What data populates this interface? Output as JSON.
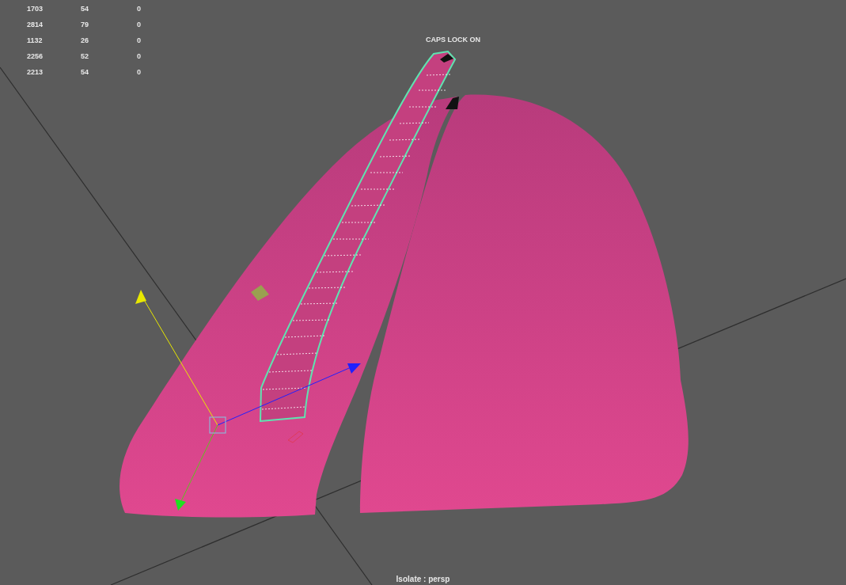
{
  "stats": [
    {
      "column_1": "1703",
      "column_2": "54",
      "column_3": "0"
    },
    {
      "column_1": "2814",
      "column_2": "79",
      "column_3": "0"
    },
    {
      "column_1": "1132",
      "column_2": "26",
      "column_3": "0"
    },
    {
      "column_1": "2256",
      "column_2": "52",
      "column_3": "0"
    },
    {
      "column_1": "2213",
      "column_2": "54",
      "column_3": "0"
    }
  ],
  "caps_lock_message": "CAPS LOCK ON",
  "camera_label": "Isolate : persp"
}
